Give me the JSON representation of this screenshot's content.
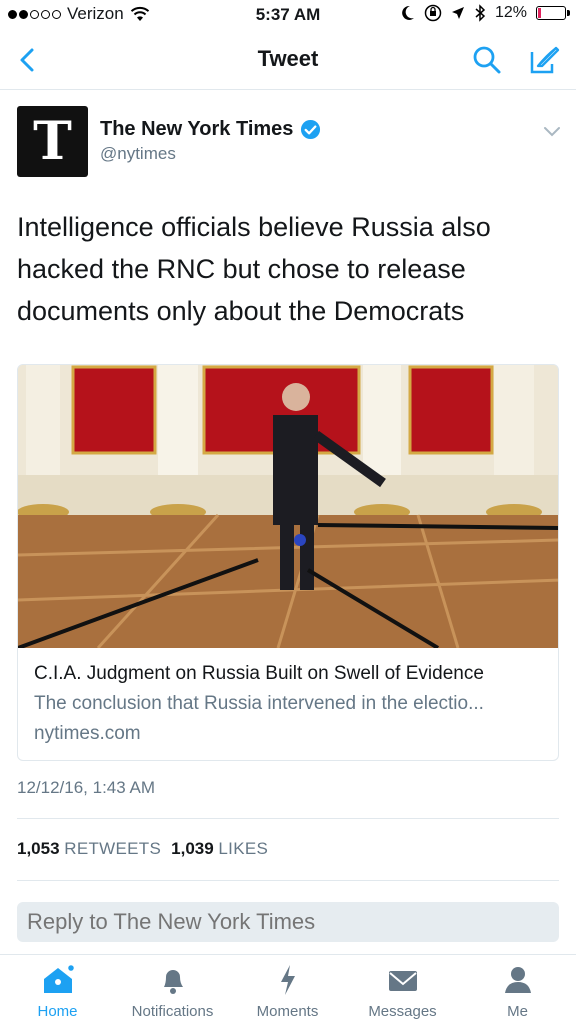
{
  "status": {
    "carrier": "Verizon",
    "time": "5:37 AM",
    "battery": "12%",
    "battery_level": 0.12
  },
  "nav": {
    "title": "Tweet",
    "back_icon": "chevron-left-icon",
    "search_icon": "search-icon",
    "compose_icon": "compose-icon"
  },
  "tweet": {
    "author_name": "The New York Times",
    "handle": "@nytimes",
    "avatar_letter": "T",
    "text": "Intelligence officials believe Russia also hacked the RNC but chose to release documents only about the Democrats",
    "timestamp": "12/12/16, 1:43 AM",
    "retweets_count": "1,053",
    "retweets_label": "RETWEETS",
    "likes_count": "1,039",
    "likes_label": "LIKES"
  },
  "card": {
    "title": "C.I.A. Judgment on Russia Built on Swell of Evidence",
    "description": "The conclusion that Russia intervened in the electio...",
    "domain": "nytimes.com"
  },
  "reply": {
    "placeholder": "Reply to The New York Times"
  },
  "tabs": [
    {
      "label": "Home",
      "icon": "home-icon",
      "active": true
    },
    {
      "label": "Notifications",
      "icon": "bell-icon",
      "active": false
    },
    {
      "label": "Moments",
      "icon": "lightning-icon",
      "active": false
    },
    {
      "label": "Messages",
      "icon": "envelope-icon",
      "active": false
    },
    {
      "label": "Me",
      "icon": "person-icon",
      "active": false
    }
  ],
  "colors": {
    "accent": "#1da1f2",
    "secondary_text": "#657786",
    "battery_low": "#e0245e"
  }
}
